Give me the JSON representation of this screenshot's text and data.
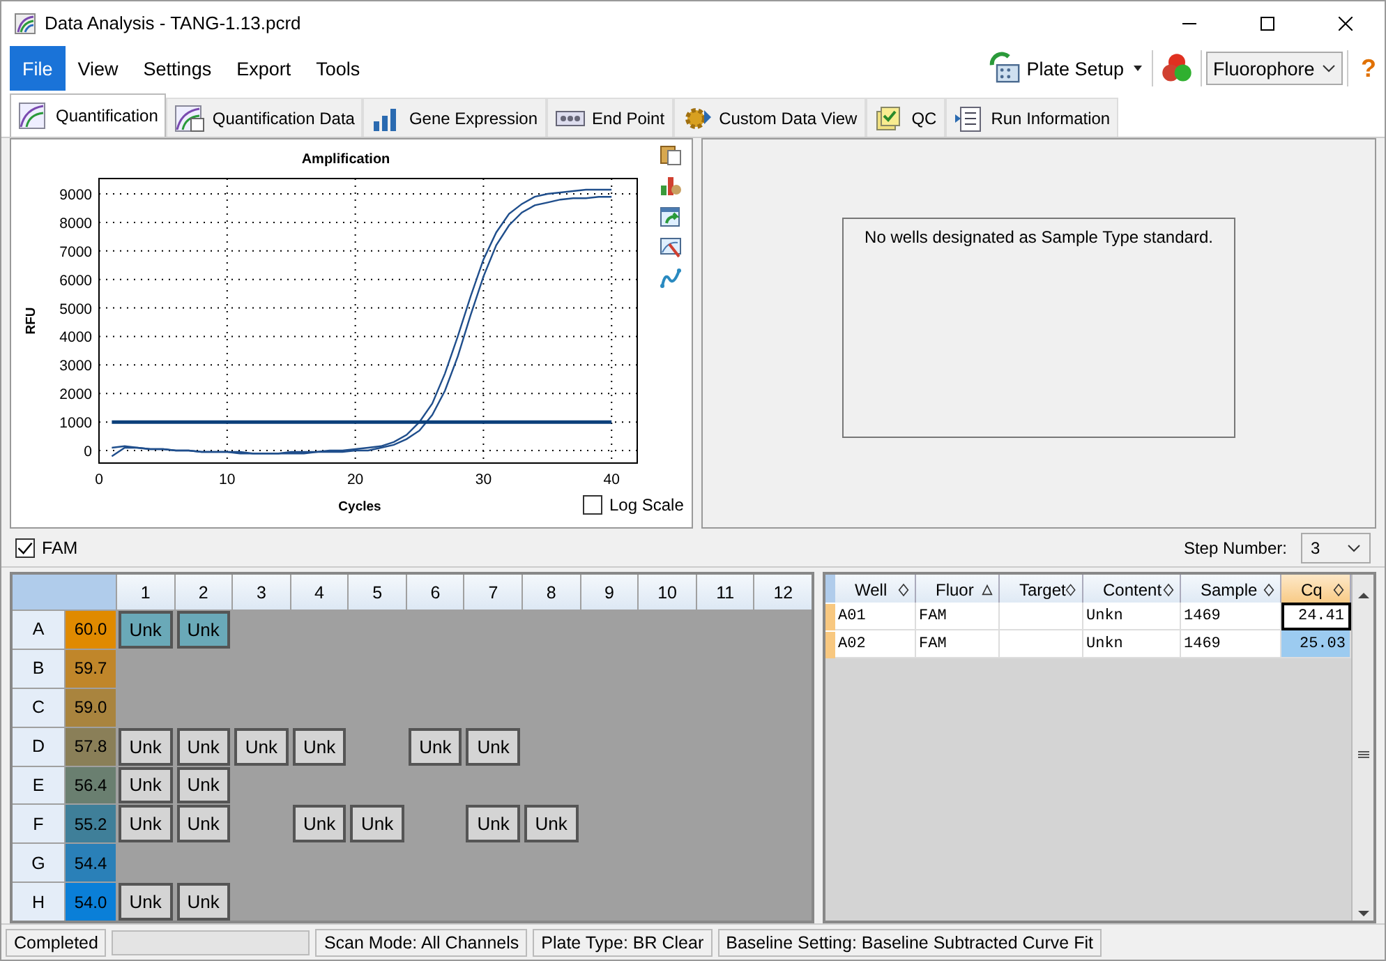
{
  "window": {
    "title": "Data Analysis - TANG-1.13.pcrd"
  },
  "menu": [
    {
      "label": "File",
      "selected": true
    },
    {
      "label": "View",
      "selected": false
    },
    {
      "label": "Settings",
      "selected": false
    },
    {
      "label": "Export",
      "selected": false
    },
    {
      "label": "Tools",
      "selected": false
    }
  ],
  "toolbar": {
    "plate_setup": "Plate Setup",
    "fluorophore": "Fluorophore",
    "help": "?"
  },
  "tabs": [
    {
      "label": "Quantification",
      "selected": true
    },
    {
      "label": "Quantification Data",
      "selected": false
    },
    {
      "label": "Gene Expression",
      "selected": false
    },
    {
      "label": "End Point",
      "selected": false
    },
    {
      "label": "Custom Data View",
      "selected": false
    },
    {
      "label": "QC",
      "selected": false
    },
    {
      "label": "Run Information",
      "selected": false
    }
  ],
  "amplification": {
    "log_scale": {
      "label": "Log Scale",
      "checked": false
    },
    "chart_data": {
      "type": "line",
      "title": "Amplification",
      "xlabel": "Cycles",
      "ylabel": "RFU",
      "grid": true,
      "x": [
        1,
        2,
        3,
        4,
        5,
        6,
        7,
        8,
        9,
        10,
        11,
        12,
        13,
        14,
        15,
        16,
        17,
        18,
        19,
        20,
        21,
        22,
        23,
        24,
        25,
        26,
        27,
        28,
        29,
        30,
        31,
        32,
        33,
        34,
        35,
        36,
        37,
        38,
        39,
        40
      ],
      "xlim": [
        0,
        42
      ],
      "ylim": [
        -440,
        9540
      ],
      "xticks": [
        0,
        10,
        20,
        30,
        40
      ],
      "yticks": [
        0,
        1000,
        2000,
        3000,
        4000,
        5000,
        6000,
        7000,
        8000,
        9000
      ],
      "series": [
        {
          "color": "#1f4e8c",
          "values": [
            100,
            150,
            100,
            50,
            50,
            0,
            0,
            -50,
            -50,
            -50,
            -50,
            -100,
            -100,
            -100,
            -50,
            -50,
            -50,
            0,
            0,
            50,
            100,
            150,
            300,
            550,
            1000,
            1650,
            2700,
            4000,
            5400,
            6700,
            7650,
            8300,
            8650,
            8900,
            9000,
            9050,
            9100,
            9150,
            9150,
            9150
          ]
        },
        {
          "color": "#1f4e8c",
          "values": [
            -200,
            100,
            100,
            50,
            50,
            0,
            0,
            -50,
            -50,
            -50,
            -100,
            -100,
            -100,
            -100,
            -100,
            -100,
            -50,
            -50,
            -50,
            0,
            0,
            100,
            200,
            400,
            700,
            1250,
            2100,
            3300,
            4750,
            6100,
            7200,
            7900,
            8350,
            8600,
            8700,
            8800,
            8850,
            8850,
            8900,
            8900
          ]
        },
        {
          "color": "#0b3f7a",
          "values": [
            1000,
            1000,
            1000,
            1000,
            1000,
            1000,
            1000,
            1000,
            1000,
            1000,
            1000,
            1000,
            1000,
            1000,
            1000,
            1000,
            1000,
            1000,
            1000,
            1000,
            1000,
            1000,
            1000,
            1000,
            1000,
            1000,
            1000,
            1000,
            1000,
            1000,
            1000,
            1000,
            1000,
            1000,
            1000,
            1000,
            1000,
            1000,
            1000,
            1000
          ]
        }
      ]
    }
  },
  "standard_curve": {
    "message": "No wells designated as Sample Type standard."
  },
  "fluor_filter": {
    "label": "FAM",
    "checked": true
  },
  "step_number": {
    "label": "Step Number:",
    "value": "3"
  },
  "plate": {
    "columns": [
      "1",
      "2",
      "3",
      "4",
      "5",
      "6",
      "7",
      "8",
      "9",
      "10",
      "11",
      "12"
    ],
    "rows": [
      {
        "label": "A",
        "temperature": "60.0",
        "color": "#e08a00",
        "wells": [
          {
            "kind": "sample",
            "label": "Unk",
            "selected": true
          },
          {
            "kind": "sample",
            "label": "Unk",
            "selected": true
          },
          {
            "kind": "empty"
          },
          {
            "kind": "empty"
          },
          {
            "kind": "empty"
          },
          {
            "kind": "empty"
          },
          {
            "kind": "empty"
          },
          {
            "kind": "empty"
          },
          {
            "kind": "empty"
          },
          {
            "kind": "empty"
          },
          {
            "kind": "empty"
          },
          {
            "kind": "empty"
          }
        ]
      },
      {
        "label": "B",
        "temperature": "59.7",
        "color": "#c0862a",
        "wells": [
          {
            "kind": "empty"
          },
          {
            "kind": "empty"
          },
          {
            "kind": "empty"
          },
          {
            "kind": "empty"
          },
          {
            "kind": "empty"
          },
          {
            "kind": "empty"
          },
          {
            "kind": "empty"
          },
          {
            "kind": "empty"
          },
          {
            "kind": "empty"
          },
          {
            "kind": "empty"
          },
          {
            "kind": "empty"
          },
          {
            "kind": "empty"
          }
        ]
      },
      {
        "label": "C",
        "temperature": "59.0",
        "color": "#a9843e",
        "wells": [
          {
            "kind": "empty"
          },
          {
            "kind": "empty"
          },
          {
            "kind": "empty"
          },
          {
            "kind": "empty"
          },
          {
            "kind": "empty"
          },
          {
            "kind": "empty"
          },
          {
            "kind": "empty"
          },
          {
            "kind": "empty"
          },
          {
            "kind": "empty"
          },
          {
            "kind": "empty"
          },
          {
            "kind": "empty"
          },
          {
            "kind": "empty"
          }
        ]
      },
      {
        "label": "D",
        "temperature": "57.8",
        "color": "#8a7f58",
        "wells": [
          {
            "kind": "sample",
            "label": "Unk",
            "selected": false
          },
          {
            "kind": "sample",
            "label": "Unk",
            "selected": false
          },
          {
            "kind": "sample",
            "label": "Unk",
            "selected": false
          },
          {
            "kind": "sample",
            "label": "Unk",
            "selected": false
          },
          {
            "kind": "empty"
          },
          {
            "kind": "sample",
            "label": "Unk",
            "selected": false
          },
          {
            "kind": "sample",
            "label": "Unk",
            "selected": false
          },
          {
            "kind": "empty"
          },
          {
            "kind": "empty"
          },
          {
            "kind": "empty"
          },
          {
            "kind": "empty"
          },
          {
            "kind": "empty"
          }
        ]
      },
      {
        "label": "E",
        "temperature": "56.4",
        "color": "#6a7f70",
        "wells": [
          {
            "kind": "sample",
            "label": "Unk",
            "selected": false
          },
          {
            "kind": "sample",
            "label": "Unk",
            "selected": false
          },
          {
            "kind": "empty"
          },
          {
            "kind": "empty"
          },
          {
            "kind": "empty"
          },
          {
            "kind": "empty"
          },
          {
            "kind": "empty"
          },
          {
            "kind": "empty"
          },
          {
            "kind": "empty"
          },
          {
            "kind": "empty"
          },
          {
            "kind": "empty"
          },
          {
            "kind": "empty"
          }
        ]
      },
      {
        "label": "F",
        "temperature": "55.2",
        "color": "#3f7f99",
        "wells": [
          {
            "kind": "sample",
            "label": "Unk",
            "selected": false
          },
          {
            "kind": "sample",
            "label": "Unk",
            "selected": false
          },
          {
            "kind": "empty"
          },
          {
            "kind": "sample",
            "label": "Unk",
            "selected": false
          },
          {
            "kind": "sample",
            "label": "Unk",
            "selected": false
          },
          {
            "kind": "empty"
          },
          {
            "kind": "sample",
            "label": "Unk",
            "selected": false
          },
          {
            "kind": "sample",
            "label": "Unk",
            "selected": false
          },
          {
            "kind": "empty"
          },
          {
            "kind": "empty"
          },
          {
            "kind": "empty"
          },
          {
            "kind": "empty"
          }
        ]
      },
      {
        "label": "G",
        "temperature": "54.4",
        "color": "#2a80b8",
        "wells": [
          {
            "kind": "empty"
          },
          {
            "kind": "empty"
          },
          {
            "kind": "empty"
          },
          {
            "kind": "empty"
          },
          {
            "kind": "empty"
          },
          {
            "kind": "empty"
          },
          {
            "kind": "empty"
          },
          {
            "kind": "empty"
          },
          {
            "kind": "empty"
          },
          {
            "kind": "empty"
          },
          {
            "kind": "empty"
          },
          {
            "kind": "empty"
          }
        ]
      },
      {
        "label": "H",
        "temperature": "54.0",
        "color": "#0a7fd8",
        "wells": [
          {
            "kind": "sample",
            "label": "Unk",
            "selected": false
          },
          {
            "kind": "sample",
            "label": "Unk",
            "selected": false
          },
          {
            "kind": "empty"
          },
          {
            "kind": "empty"
          },
          {
            "kind": "empty"
          },
          {
            "kind": "empty"
          },
          {
            "kind": "empty"
          },
          {
            "kind": "empty"
          },
          {
            "kind": "empty"
          },
          {
            "kind": "empty"
          },
          {
            "kind": "empty"
          },
          {
            "kind": "empty"
          }
        ]
      }
    ]
  },
  "results": {
    "columns": [
      {
        "label": "Well",
        "sorted": false,
        "selected": false
      },
      {
        "label": "Fluor",
        "sorted": true,
        "selected": false
      },
      {
        "label": "Target",
        "sorted": false,
        "selected": false
      },
      {
        "label": "Content",
        "sorted": false,
        "selected": false
      },
      {
        "label": "Sample",
        "sorted": false,
        "selected": false
      },
      {
        "label": "Cq",
        "sorted": false,
        "selected": true
      }
    ],
    "rows": [
      {
        "cells": [
          "A01",
          "FAM",
          "",
          "Unkn",
          "1469",
          "24.41"
        ],
        "focused": true,
        "selected": false
      },
      {
        "cells": [
          "A02",
          "FAM",
          "",
          "Unkn",
          "1469",
          "25.03"
        ],
        "focused": false,
        "selected": true
      }
    ]
  },
  "progress": {
    "level": 0
  },
  "status_bar": [
    "Completed",
    "Scan Mode: All Channels",
    "Plate Type: BR Clear",
    "Baseline Setting: Baseline Subtracted Curve Fit"
  ]
}
